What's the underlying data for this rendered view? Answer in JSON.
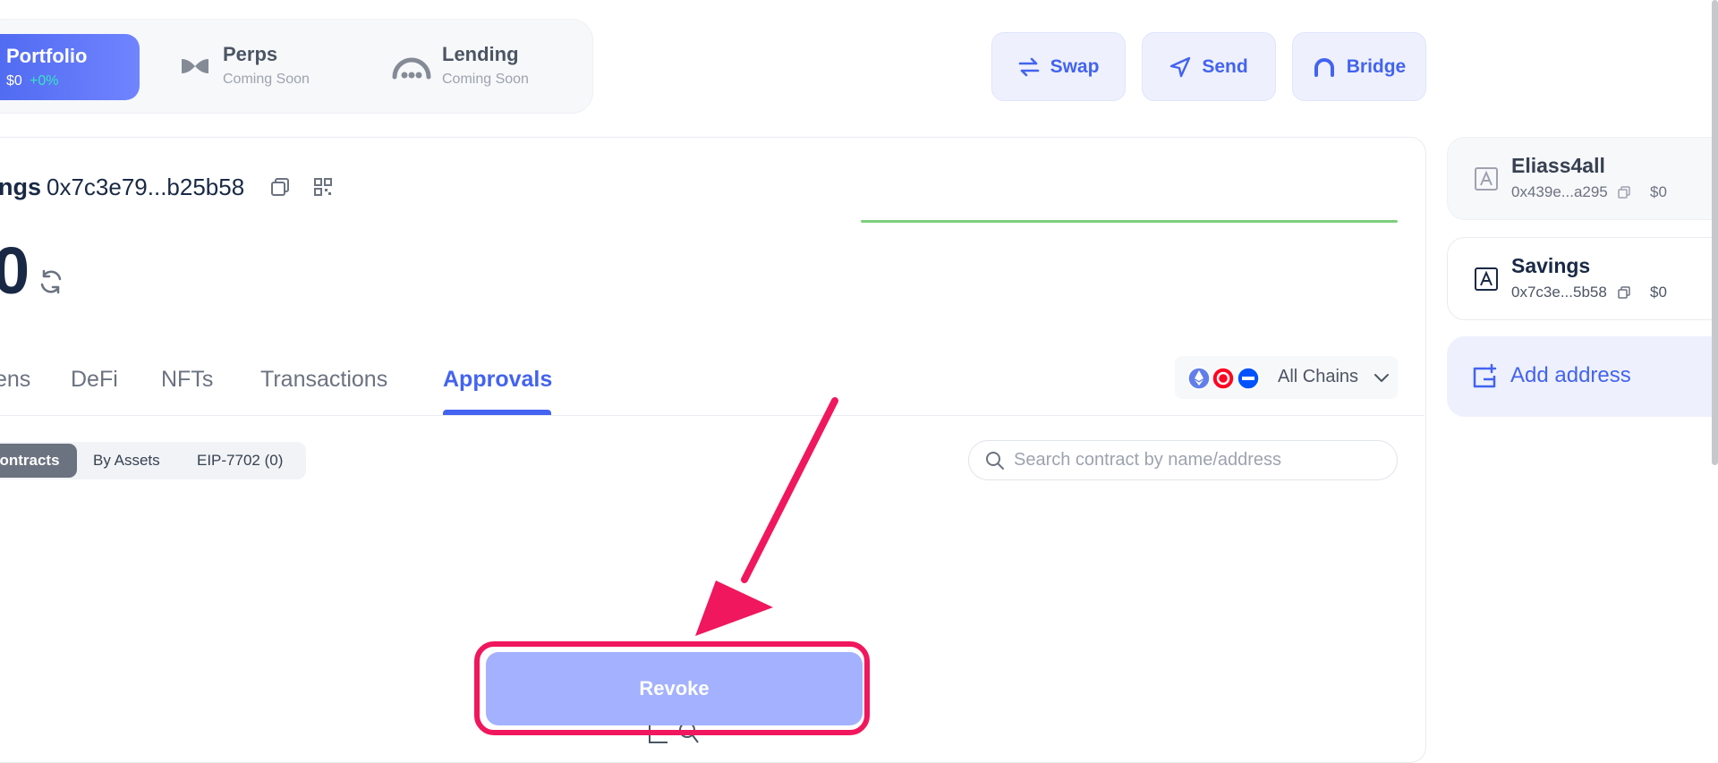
{
  "nav": {
    "portfolio": {
      "title": "Portfolio",
      "value": "$0",
      "change": "+0%"
    },
    "perps": {
      "title": "Perps",
      "sub": "Coming Soon"
    },
    "lending": {
      "title": "Lending",
      "sub": "Coming Soon"
    }
  },
  "actions": {
    "swap": "Swap",
    "send": "Send",
    "bridge": "Bridge"
  },
  "wallet": {
    "name_partial": "ngs",
    "address": "0x7c3e79...b25b58",
    "balance_partial": "0"
  },
  "tabs": [
    {
      "label": "ens"
    },
    {
      "label": "DeFi"
    },
    {
      "label": "NFTs"
    },
    {
      "label": "Transactions"
    },
    {
      "label": "Approvals",
      "active": true
    }
  ],
  "chains": {
    "label": "All Chains",
    "colors": [
      "#627eea",
      "#ff0420",
      "#0052ff"
    ]
  },
  "filters": [
    "ontracts",
    "By Assets",
    "EIP-7702 (0)"
  ],
  "search": {
    "placeholder": "Search contract by name/address"
  },
  "revoke": {
    "label": "Revoke"
  },
  "accounts": [
    {
      "name": "Eliass4all",
      "address": "0x439e...a295",
      "balance": "$0"
    },
    {
      "name": "Savings",
      "address": "0x7c3e...5b58",
      "balance": "$0"
    }
  ],
  "add_address": "Add address",
  "colors": {
    "accent": "#4363f0",
    "highlight": "#f0175e",
    "revoke_bg": "#a3b1ff",
    "sparkline": "#7ecf7f"
  }
}
